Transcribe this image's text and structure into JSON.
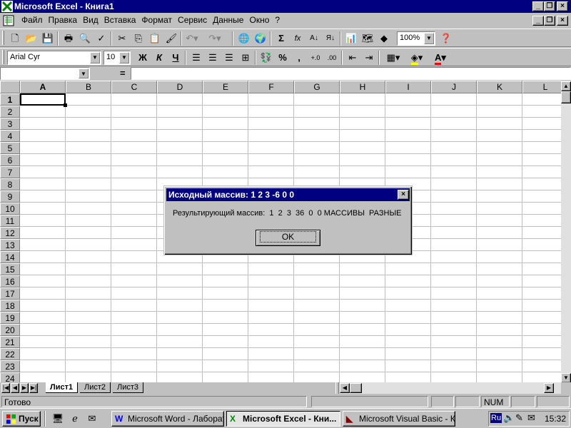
{
  "window": {
    "title": "Microsoft Excel - Книга1"
  },
  "menu": [
    "Файл",
    "Правка",
    "Вид",
    "Вставка",
    "Формат",
    "Сервис",
    "Данные",
    "Окно",
    "?"
  ],
  "toolbar": {
    "zoom": "100%",
    "font_name": "Arial Cyr",
    "font_size": "10",
    "bold": "Ж",
    "italic": "К",
    "underline": "Ч",
    "percent": "%",
    "comma": ",",
    "sum": "Σ",
    "fx": "fx"
  },
  "formula_bar": {
    "name_box": "",
    "equals": "="
  },
  "grid": {
    "columns": [
      "A",
      "B",
      "C",
      "D",
      "E",
      "F",
      "G",
      "H",
      "I",
      "J",
      "K",
      "L"
    ],
    "rows": [
      "1",
      "2",
      "3",
      "4",
      "5",
      "6",
      "7",
      "8",
      "9",
      "10",
      "11",
      "12",
      "13",
      "14",
      "15",
      "16",
      "17",
      "18",
      "19",
      "20",
      "21",
      "22",
      "23",
      "24"
    ],
    "active_cell": "A1"
  },
  "sheets": [
    "Лист1",
    "Лист2",
    "Лист3"
  ],
  "active_sheet": "Лист1",
  "status": {
    "text": "Готово",
    "num": "NUM"
  },
  "dialog": {
    "title": "Исходный массив:  1  2  3 -6  0  0",
    "message": "Результирующий массив:  1  2  3  36  0  0 МАССИВЫ  РАЗНЫЕ",
    "ok_label": "OK"
  },
  "taskbar": {
    "start_label": "Пуск",
    "tasks": [
      "Microsoft Word - Лаборат...",
      "Microsoft Excel - Кни...",
      "Microsoft Visual Basic - Кн..."
    ],
    "active_task": 1,
    "lang": "Ru",
    "clock": "15:32"
  }
}
